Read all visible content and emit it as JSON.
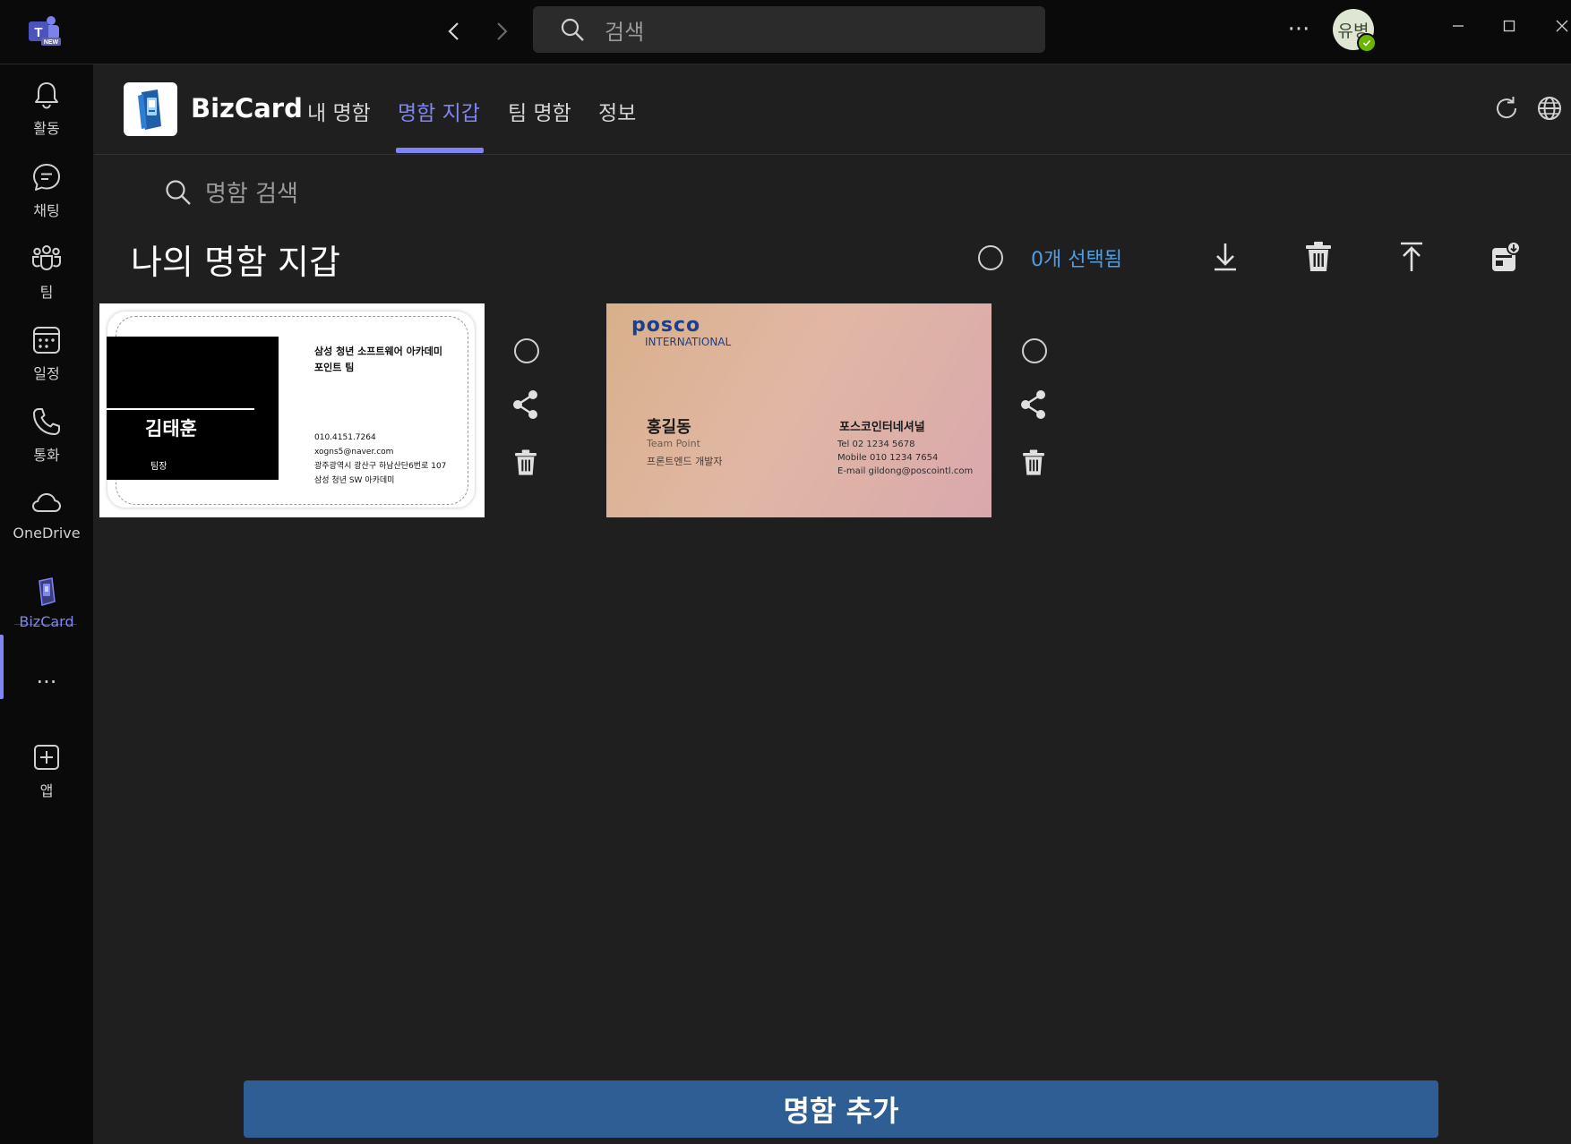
{
  "titlebar": {
    "search_placeholder": "검색",
    "more": "···",
    "avatar_initials": "유병"
  },
  "rail": {
    "items": [
      {
        "label": "활동",
        "icon": "bell-icon"
      },
      {
        "label": "채팅",
        "icon": "chat-icon"
      },
      {
        "label": "팀",
        "icon": "teams-icon"
      },
      {
        "label": "일정",
        "icon": "calendar-icon"
      },
      {
        "label": "통화",
        "icon": "phone-icon"
      },
      {
        "label": "OneDrive",
        "icon": "cloud-icon"
      },
      {
        "label": "BizCard",
        "icon": "bizcard-icon"
      },
      {
        "label": "···",
        "icon": "more-icon"
      },
      {
        "label": "앱",
        "icon": "add-app-icon"
      }
    ]
  },
  "app": {
    "name": "BizCard",
    "tabs": [
      {
        "label": "내 명함"
      },
      {
        "label": "명함 지갑",
        "active": true
      },
      {
        "label": "팀 명함"
      },
      {
        "label": "정보"
      }
    ]
  },
  "content": {
    "search_placeholder": "명함 검색",
    "title": "나의 명함 지갑",
    "selected_count": "0개 선택됨",
    "add_button": "명함 추가"
  },
  "cards": [
    {
      "org_line1": "삼성 청년 소프트웨어 아카데미",
      "org_line2": "포인트 팀",
      "name": "김태훈",
      "role": "팀장",
      "phone": "010.4151.7264",
      "email": "xogns5@naver.com",
      "address": "광주광역시 광산구 하남산단6번로 107",
      "company": "삼성 청년 SW 아카데미"
    },
    {
      "brand": "posco",
      "brand_sub": "INTERNATIONAL",
      "name": "홍길동",
      "team": "Team Point",
      "role": "프론트엔드 개발자",
      "company": "포스코인터네셔널",
      "tel": "Tel  02 1234 5678",
      "mobile": "Mobile  010 1234 7654",
      "email": "E-mail  gildong@poscointl.com"
    }
  ],
  "colors": {
    "accent": "#7f85f5",
    "link": "#4f9fe6",
    "button": "#2e5e93",
    "background": "#1f1f1f",
    "rail": "#0a0a0a"
  }
}
